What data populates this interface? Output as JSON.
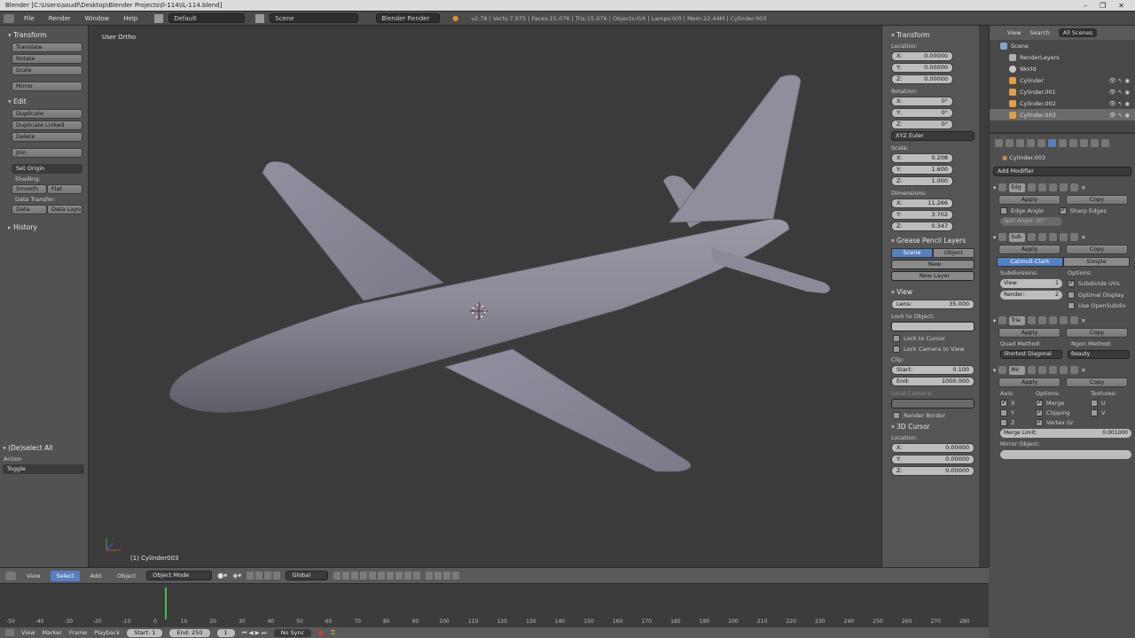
{
  "window": {
    "title": "Blender [C:\\Users\\soudf\\Desktop\\Blender Projects\\Il-114\\IL-114.blend]",
    "controls": [
      "–",
      "❐",
      "✕"
    ]
  },
  "info_header": {
    "menus": [
      "File",
      "Render",
      "Window",
      "Help"
    ],
    "layout": "Default",
    "scene": "Scene",
    "engine": "Blender Render",
    "stats": "v2.78 | Verts:7,975 | Faces:15,076 | Tris:15,076 | Objects:0/4 | Lamps:0/0 | Mem:22.44M | Cylinder.003"
  },
  "tool_shelf": {
    "transform_title": "Transform",
    "transform_buttons": [
      "Translate",
      "Rotate",
      "Scale"
    ],
    "mirror": "Mirror",
    "edit_title": "Edit",
    "edit_buttons": [
      "Duplicate",
      "Duplicate Linked",
      "Delete"
    ],
    "join": "Join",
    "set_origin": "Set Origin",
    "shading_label": "Shading:",
    "smooth": "Smooth",
    "flat": "Flat",
    "data_transfer_label": "Data Transfer:",
    "data": "Data",
    "data_layout": "Data Layo",
    "history": "History"
  },
  "operator_panel": {
    "title": "(De)select All",
    "action_label": "Action",
    "action_value": "Toggle"
  },
  "viewport": {
    "view_label": "User Ortho",
    "object_label": "(1) Cylinder003"
  },
  "properties": {
    "transform_title": "Transform",
    "location_label": "Location:",
    "location": [
      {
        "axis": "X:",
        "value": "0.00000"
      },
      {
        "axis": "Y:",
        "value": "0.00000"
      },
      {
        "axis": "Z:",
        "value": "0.00000"
      }
    ],
    "rotation_label": "Rotation:",
    "rotation": [
      {
        "axis": "X:",
        "value": "0°"
      },
      {
        "axis": "Y:",
        "value": "0°"
      },
      {
        "axis": "Z:",
        "value": "0°"
      }
    ],
    "rotation_mode": "XYZ Euler",
    "scale_label": "Scale:",
    "scale": [
      {
        "axis": "X:",
        "value": "0.208"
      },
      {
        "axis": "Y:",
        "value": "1.600"
      },
      {
        "axis": "Z:",
        "value": "1.000"
      }
    ],
    "dimensions_label": "Dimensions:",
    "dimensions": [
      {
        "axis": "X:",
        "value": "11.266"
      },
      {
        "axis": "Y:",
        "value": "3.702"
      },
      {
        "axis": "Z:",
        "value": "0.347"
      }
    ],
    "grease_title": "Grease Pencil Layers",
    "grease_scene": "Scene",
    "grease_object": "Object",
    "grease_new": "New",
    "grease_new_layer": "New Layer",
    "view_title": "View",
    "lens_label": "Lens:",
    "lens_value": "35.000",
    "lock_to_object": "Lock to Object:",
    "lock_to_cursor": "Lock to Cursor",
    "lock_camera": "Lock Camera to View",
    "clip_label": "Clip:",
    "clip_start_label": "Start:",
    "clip_start": "0.100",
    "clip_end_label": "End:",
    "clip_end": "1000.000",
    "local_camera": "Local Camera:",
    "render_border": "Render Border",
    "cursor_title": "3D Cursor",
    "cursor_location_label": "Location:",
    "cursor": [
      {
        "axis": "X:",
        "value": "0.00000"
      },
      {
        "axis": "Y:",
        "value": "0.00000"
      },
      {
        "axis": "Z:",
        "value": "0.00000"
      }
    ]
  },
  "outliner": {
    "tabs": [
      "View",
      "Search",
      "All Scenes"
    ],
    "items": [
      {
        "label": "Scene",
        "color": "#8aa2c8"
      },
      {
        "label": "RenderLayers",
        "color": "#b0b0b0"
      },
      {
        "label": "World",
        "color": "#c8c8c8"
      },
      {
        "label": "Cylinder",
        "color": "#e0a040"
      },
      {
        "label": "Cylinder.001",
        "color": "#e0a040"
      },
      {
        "label": "Cylinder.002",
        "color": "#e0a040"
      },
      {
        "label": "Cylinder.003",
        "color": "#e0a040"
      }
    ]
  },
  "modifiers": {
    "object_name": "Cylinder.003",
    "add_modifier": "Add Modifier",
    "apply": "Apply",
    "copy": "Copy",
    "edge_split": {
      "name": "Edg",
      "edge_angle": "Edge Angle",
      "sharp_edges": "Sharp Edges",
      "split_angle": "Split Angle: 30°"
    },
    "subsurf": {
      "name": "Sub",
      "catmull": "Catmull-Clark",
      "simple": "Simple",
      "subdivisions_label": "Subdivisions:",
      "options_label": "Options:",
      "view_label": "View:",
      "view_value": "1",
      "render_label": "Render:",
      "render_value": "2",
      "subdivide_uvs": "Subdivide UVs",
      "optimal_display": "Optimal Display",
      "use_opensubdiv": "Use OpenSubdiv"
    },
    "triangulate": {
      "name": "Tria",
      "quad_method_label": "Quad Method:",
      "quad_method": "Shortest Diagonal",
      "ngon_method_label": "Ngon Method:",
      "ngon_method": "Beauty"
    },
    "mirror": {
      "name": "Mir",
      "axis_label": "Axis:",
      "options_label": "Options:",
      "textures_label": "Textures:",
      "x": "X",
      "y": "Y",
      "z": "Z",
      "merge": "Merge",
      "clipping": "Clipping",
      "vertex_gr": "Vertex Gr",
      "u": "U",
      "v": "V",
      "merge_limit_label": "Merge Limit:",
      "merge_limit": "0.001000",
      "mirror_object_label": "Mirror Object:"
    }
  },
  "view_header": {
    "menus": [
      "View",
      "Select",
      "Add",
      "Object"
    ],
    "mode": "Object Mode",
    "orientation": "Global"
  },
  "timeline": {
    "ticks": [
      "-50",
      "-40",
      "-30",
      "-20",
      "-10",
      "0",
      "10",
      "20",
      "30",
      "40",
      "50",
      "60",
      "70",
      "80",
      "90",
      "100",
      "110",
      "120",
      "130",
      "140",
      "150",
      "160",
      "170",
      "180",
      "190",
      "200",
      "210",
      "220",
      "230",
      "240",
      "250",
      "260",
      "270",
      "280"
    ],
    "menus": [
      "View",
      "Marker",
      "Frame",
      "Playback"
    ],
    "start_label": "Start:",
    "start": "1",
    "end_label": "End:",
    "end": "250",
    "current": "1",
    "sync": "No Sync"
  }
}
